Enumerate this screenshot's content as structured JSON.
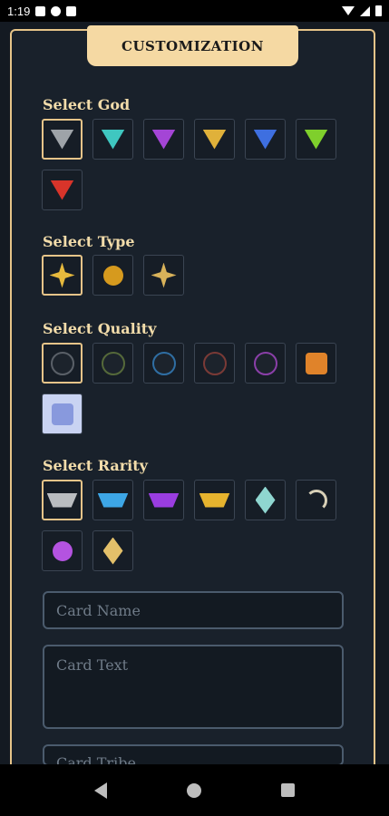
{
  "status_bar": {
    "time": "1:19",
    "icons": [
      "photo-icon",
      "fan-icon",
      "sd-card-icon",
      "wifi-icon",
      "signal-icon",
      "battery-icon"
    ]
  },
  "header": {
    "title": "CUSTOMIZATION"
  },
  "sections": {
    "god": {
      "label": "Select God",
      "selected_index": 0,
      "options": [
        {
          "icon": "silver-god-icon",
          "color": "#9ea3a8"
        },
        {
          "icon": "teal-god-icon",
          "color": "#3fc7c0"
        },
        {
          "icon": "purple-god-icon",
          "color": "#a445d6"
        },
        {
          "icon": "gold-god-icon",
          "color": "#e0b13a"
        },
        {
          "icon": "blue-god-icon",
          "color": "#3e6fe0"
        },
        {
          "icon": "green-god-icon",
          "color": "#7fcf2c"
        },
        {
          "icon": "red-god-icon",
          "color": "#d8342a"
        }
      ]
    },
    "type": {
      "label": "Select Type",
      "selected_index": 0,
      "options": [
        {
          "icon": "crossed-swords-icon",
          "color": "#e6b93d"
        },
        {
          "icon": "orb-icon",
          "color": "#d69a1e"
        },
        {
          "icon": "crossed-swords-alt-icon",
          "color": "#d8b25a"
        }
      ]
    },
    "quality": {
      "label": "Select Quality",
      "selected_index": 0,
      "options": [
        {
          "icon": "quality-grey-icon",
          "color": "#5a6068"
        },
        {
          "icon": "quality-green-icon",
          "color": "#55693a"
        },
        {
          "icon": "quality-blue-icon",
          "color": "#2f6ea3"
        },
        {
          "icon": "quality-red-icon",
          "color": "#7a3a36"
        },
        {
          "icon": "quality-purple-icon",
          "color": "#8a3fa8"
        },
        {
          "icon": "quality-orange-icon",
          "color": "#e0832a"
        },
        {
          "icon": "quality-white-icon",
          "color": "#8899dd"
        }
      ]
    },
    "rarity": {
      "label": "Select Rarity",
      "selected_index": 0,
      "options": [
        {
          "icon": "rarity-silver-icon",
          "color": "#b9bcc0"
        },
        {
          "icon": "rarity-blue-icon",
          "color": "#3da6e6"
        },
        {
          "icon": "rarity-purple-icon",
          "color": "#9a3de0"
        },
        {
          "icon": "rarity-gold-icon",
          "color": "#e6b32e"
        },
        {
          "icon": "rarity-crystal-icon",
          "color": "#8fd6d0"
        },
        {
          "icon": "rarity-arc-icon",
          "color": "#d8d0b8"
        },
        {
          "icon": "rarity-orb-icon",
          "color": "#b453e0"
        },
        {
          "icon": "rarity-crown-icon",
          "color": "#e3c06a"
        }
      ]
    }
  },
  "fields": {
    "card_name": {
      "placeholder": "Card Name"
    },
    "card_text": {
      "placeholder": "Card Text"
    },
    "card_tribe": {
      "placeholder": "Card Tribe"
    }
  },
  "nav": {
    "icons": [
      "back-icon",
      "home-icon",
      "recents-icon"
    ]
  },
  "colors": {
    "accent": "#e6c489",
    "panel": "#19212b",
    "field_border": "#4b5b6d"
  }
}
